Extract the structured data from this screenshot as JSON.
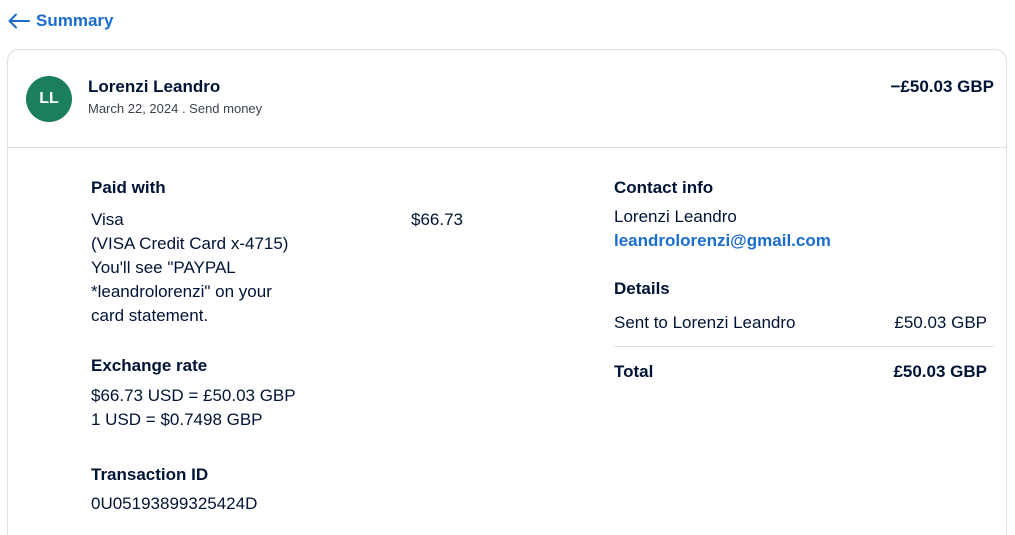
{
  "nav": {
    "back_label": "Summary"
  },
  "transaction": {
    "avatar_initials": "LL",
    "avatar_color": "#1a7f5a",
    "name": "Lorenzi Leandro",
    "date_type": "March 22, 2024 . Send money",
    "amount": "−£50.03 GBP"
  },
  "paid_with": {
    "heading": "Paid with",
    "lines": [
      "Visa",
      "(VISA Credit Card x-4715)",
      "You'll see \"PAYPAL",
      "*leandrolorenzi\" on your",
      "card statement."
    ],
    "amount": "$66.73"
  },
  "exchange": {
    "heading": "Exchange rate",
    "line1": "$66.73 USD = £50.03 GBP",
    "line2": "1 USD = $0.7498 GBP"
  },
  "transaction_id": {
    "heading": "Transaction ID",
    "value": "0U05193899325424D"
  },
  "contact": {
    "heading": "Contact info",
    "name": "Lorenzi Leandro",
    "email": "leandrolorenzi@gmail.com"
  },
  "details": {
    "heading": "Details",
    "sent_label": "Sent to Lorenzi Leandro",
    "sent_amount": "£50.03 GBP",
    "total_label": "Total",
    "total_amount": "£50.03 GBP"
  },
  "colors": {
    "link": "#1a6dcf",
    "text": "#001435",
    "border": "#dcdfe3"
  },
  "icons": {
    "back": "arrow-left-icon"
  }
}
